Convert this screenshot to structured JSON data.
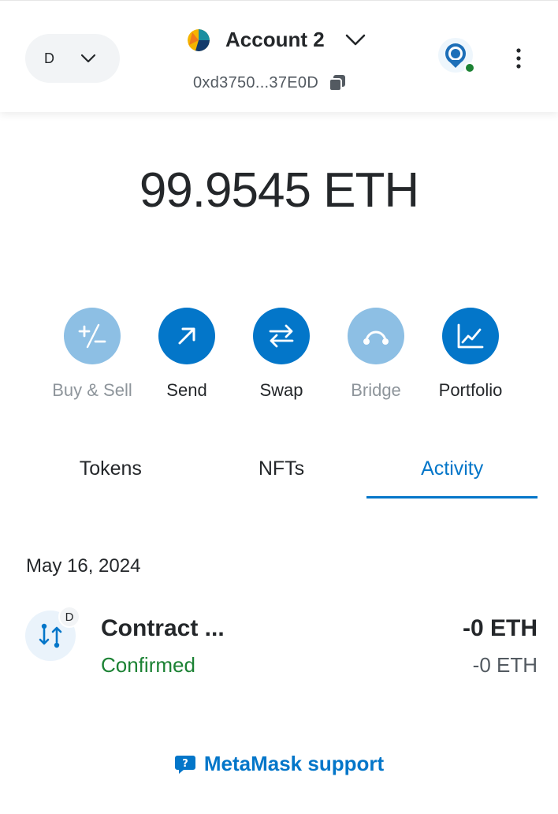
{
  "header": {
    "network_letter": "D",
    "account_name": "Account 2",
    "address": "0xd3750...37E0D"
  },
  "balance": {
    "amount": "99.9545",
    "unit": "ETH"
  },
  "actions": [
    {
      "label": "Buy & Sell",
      "icon": "plus-minus-icon",
      "enabled": false
    },
    {
      "label": "Send",
      "icon": "arrow-up-right-icon",
      "enabled": true
    },
    {
      "label": "Swap",
      "icon": "swap-arrows-icon",
      "enabled": true
    },
    {
      "label": "Bridge",
      "icon": "bridge-icon",
      "enabled": false
    },
    {
      "label": "Portfolio",
      "icon": "chart-icon",
      "enabled": true
    }
  ],
  "tabs": [
    {
      "label": "Tokens",
      "active": false
    },
    {
      "label": "NFTs",
      "active": false
    },
    {
      "label": "Activity",
      "active": true
    }
  ],
  "activity": {
    "date": "May 16, 2024",
    "transactions": [
      {
        "title": "Contract ...",
        "status": "Confirmed",
        "primary_amount": "-0 ETH",
        "secondary_amount": "-0 ETH",
        "network_badge": "D"
      }
    ]
  },
  "support": {
    "label": "MetaMask support"
  },
  "colors": {
    "accent": "#0376c9",
    "accent_disabled": "#8dbfe4",
    "success": "#1c8234",
    "text": "#24272a",
    "muted": "#535a61"
  }
}
